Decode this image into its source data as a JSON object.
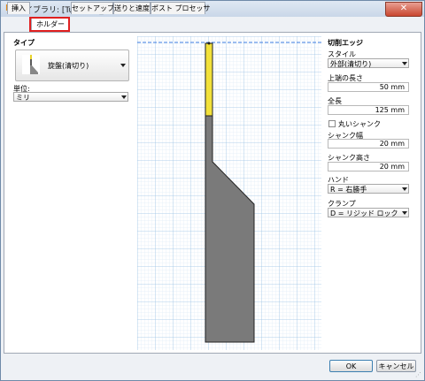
{
  "window": {
    "title": "ライブラリ: [Tutorial6_Complete]",
    "app_icon": "F"
  },
  "tabs": [
    {
      "label": "挿入"
    },
    {
      "label": "ホルダー"
    },
    {
      "label": "セットアップ"
    },
    {
      "label": "送りと速度"
    },
    {
      "label": "ポスト プロセッサ"
    }
  ],
  "active_tab": "ホルダー",
  "left": {
    "type_heading": "タイプ",
    "type_value": "旋盤(清切り)",
    "unit_label": "単位:",
    "unit_value": "ミリ"
  },
  "right": {
    "heading": "切削エッジ",
    "style_label": "スタイル",
    "style_value": "外部(清切り)",
    "top_length_label": "上端の長さ",
    "top_length_value": "50 mm",
    "total_length_label": "全長",
    "total_length_value": "125 mm",
    "round_shank_label": "丸いシャンク",
    "round_shank_checked": false,
    "shank_width_label": "シャンク幅",
    "shank_width_value": "20 mm",
    "shank_height_label": "シャンク高さ",
    "shank_height_value": "20 mm",
    "hand_label": "ハンド",
    "hand_value": "R = 右勝手",
    "clamp_label": "クランプ",
    "clamp_value": "D = リジッド ロック"
  },
  "buttons": {
    "ok": "OK",
    "cancel": "キャンセル"
  },
  "colors": {
    "cutting_edge": "#f2e13a",
    "holder_body": "#7a7a7a",
    "grid_minor": "#cfe3f6",
    "grid_major": "#9cc2e8",
    "top_line": "#3a7be0",
    "tab_highlight": "#e02020"
  }
}
